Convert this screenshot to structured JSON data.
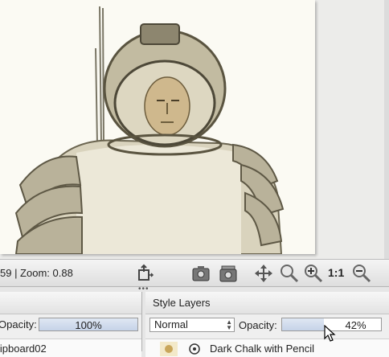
{
  "status": {
    "prefix": "59  |  Zoom: 0.88"
  },
  "toolbar": {
    "tools": [
      "crop-export-icon",
      "camera-icon",
      "camera-stack-icon",
      "move-icon",
      "zoom-icon",
      "zoom-in-icon",
      "actual-size-icon",
      "zoom-out-icon"
    ],
    "actual_size_label": "1:1"
  },
  "left_panel": {
    "opacity_label": "Opacity:",
    "opacity_value": "100%",
    "opacity_fraction": 1.0,
    "row_label": "lipboard02"
  },
  "right_panel": {
    "title": "Style Layers",
    "blend_mode": "Normal",
    "opacity_label": "Opacity:",
    "opacity_value": "42%",
    "opacity_fraction": 0.42,
    "row_label": "Dark Chalk with Pencil"
  },
  "colors": {
    "paper": "#fbfaf3",
    "accent": "#c6d3e8"
  }
}
